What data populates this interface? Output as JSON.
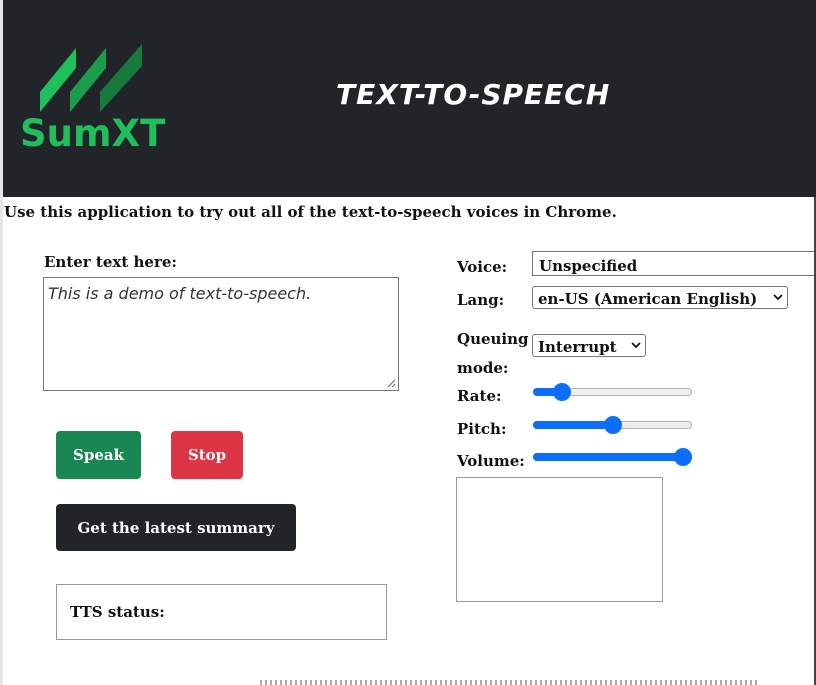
{
  "header": {
    "logo_text": "SumXT",
    "title": "TEXT-TO-SPEECH"
  },
  "intro": "Use this application to try out all of the text-to-speech voices in Chrome.",
  "input": {
    "label": "Enter text here:",
    "value": "This is a demo of text-to-speech."
  },
  "buttons": {
    "speak": "Speak",
    "stop": "Stop",
    "summary": "Get the latest summary"
  },
  "status": {
    "label": "TTS status:"
  },
  "controls": {
    "voice_label": "Voice:",
    "voice_value": "Unspecified",
    "lang_label": "Lang:",
    "lang_value": "en-US (American English)",
    "queue_label_line1": "Queuing",
    "queue_label_line2": "mode:",
    "queue_value": "Interrupt",
    "rate_label": "Rate:",
    "rate_fraction": 0.14,
    "pitch_label": "Pitch:",
    "pitch_fraction": 0.5,
    "volume_label": "Volume:",
    "volume_fraction": 1.0
  },
  "colors": {
    "header_bg": "#212529",
    "logo_green": "#1fbf5b",
    "speak_bg": "#198754",
    "stop_bg": "#dc3545",
    "summary_bg": "#212529",
    "slider_accent": "#0d6efd"
  }
}
